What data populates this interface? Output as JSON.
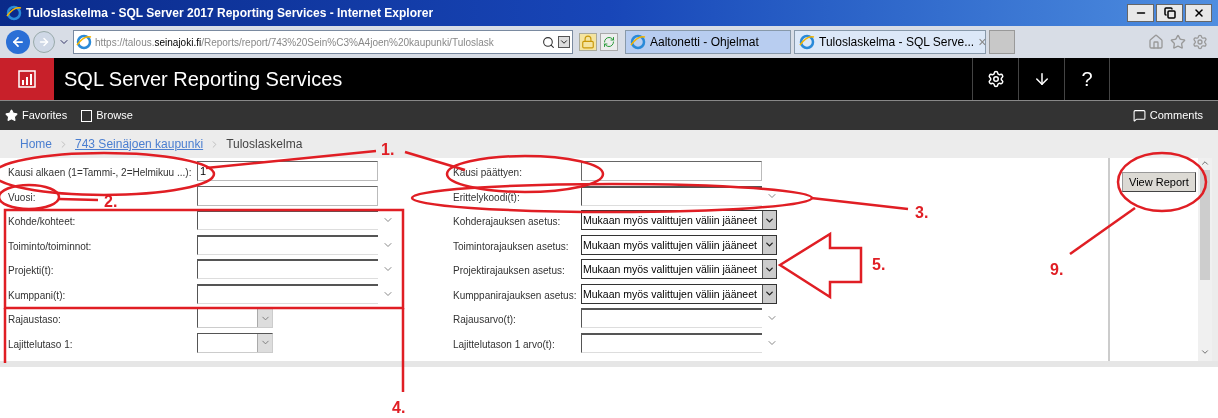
{
  "window": {
    "title": "Tuloslaskelma - SQL Server 2017 Reporting Services - Internet Explorer"
  },
  "address_bar": {
    "url_parts": [
      {
        "text": "https://talous.",
        "kind": "dim"
      },
      {
        "text": "seinajoki.fi",
        "kind": "host"
      },
      {
        "text": "/Reports/report/743%20Sein%C3%A4joen%20kaupunki/Tuloslask",
        "kind": "dim"
      }
    ]
  },
  "browser_tabs": [
    {
      "label": "Aaltonetti - Ohjelmat",
      "selected": false
    },
    {
      "label": "Tuloslaskelma - SQL Serve...",
      "selected": true,
      "close": "×"
    }
  ],
  "header": {
    "title": "SQL Server Reporting Services",
    "help": "?"
  },
  "nav": {
    "items": [
      {
        "label": "Favorites",
        "kind": "star"
      },
      {
        "label": "Browse",
        "kind": "page"
      }
    ],
    "comments": "Comments"
  },
  "breadcrumb": [
    {
      "label": "Home",
      "link": true
    },
    {
      "label": "743 Seinäjoen kaupunki",
      "link": true
    },
    {
      "label": "Tuloslaskelma",
      "link": false
    }
  ],
  "params_left": [
    {
      "label": "Kausi alkaen (1=Tammi-, 2=Helmikuu ...):",
      "kind": "text",
      "value": "1"
    },
    {
      "label": "Vuosi:",
      "kind": "text"
    },
    {
      "label": "Kohde/kohteet:",
      "kind": "multi"
    },
    {
      "label": "Toiminto/toiminnot:",
      "kind": "multi"
    },
    {
      "label": "Projekti(t):",
      "kind": "multi"
    },
    {
      "label": "Kumppani(t):",
      "kind": "multi"
    },
    {
      "label": "Rajaustaso:",
      "kind": "dropdown"
    },
    {
      "label": "Lajittelutaso 1:",
      "kind": "dropdown"
    }
  ],
  "params_right": [
    {
      "label": "Kausi päättyen:",
      "kind": "text"
    },
    {
      "label": "Erittelykoodi(t):",
      "kind": "multi"
    },
    {
      "label": "Kohderajauksen asetus:",
      "kind": "select",
      "value": "Mukaan myös valittujen väliin jääneet"
    },
    {
      "label": "Toimintorajauksen asetus:",
      "kind": "select",
      "value": "Mukaan myös valittujen väliin jääneet"
    },
    {
      "label": "Projektirajauksen asetus:",
      "kind": "select",
      "value": "Mukaan myös valittujen väliin jääneet"
    },
    {
      "label": "Kumppanirajauksen asetus:",
      "kind": "select",
      "value": "Mukaan myös valittujen väliin jääneet"
    },
    {
      "label": "Rajausarvo(t):",
      "kind": "multi"
    },
    {
      "label": "Lajittelutason 1 arvo(t):",
      "kind": "multi"
    }
  ],
  "view_report": "View Report",
  "annotations": [
    "1.",
    "2.",
    "3.",
    "4.",
    "5.",
    "9."
  ]
}
